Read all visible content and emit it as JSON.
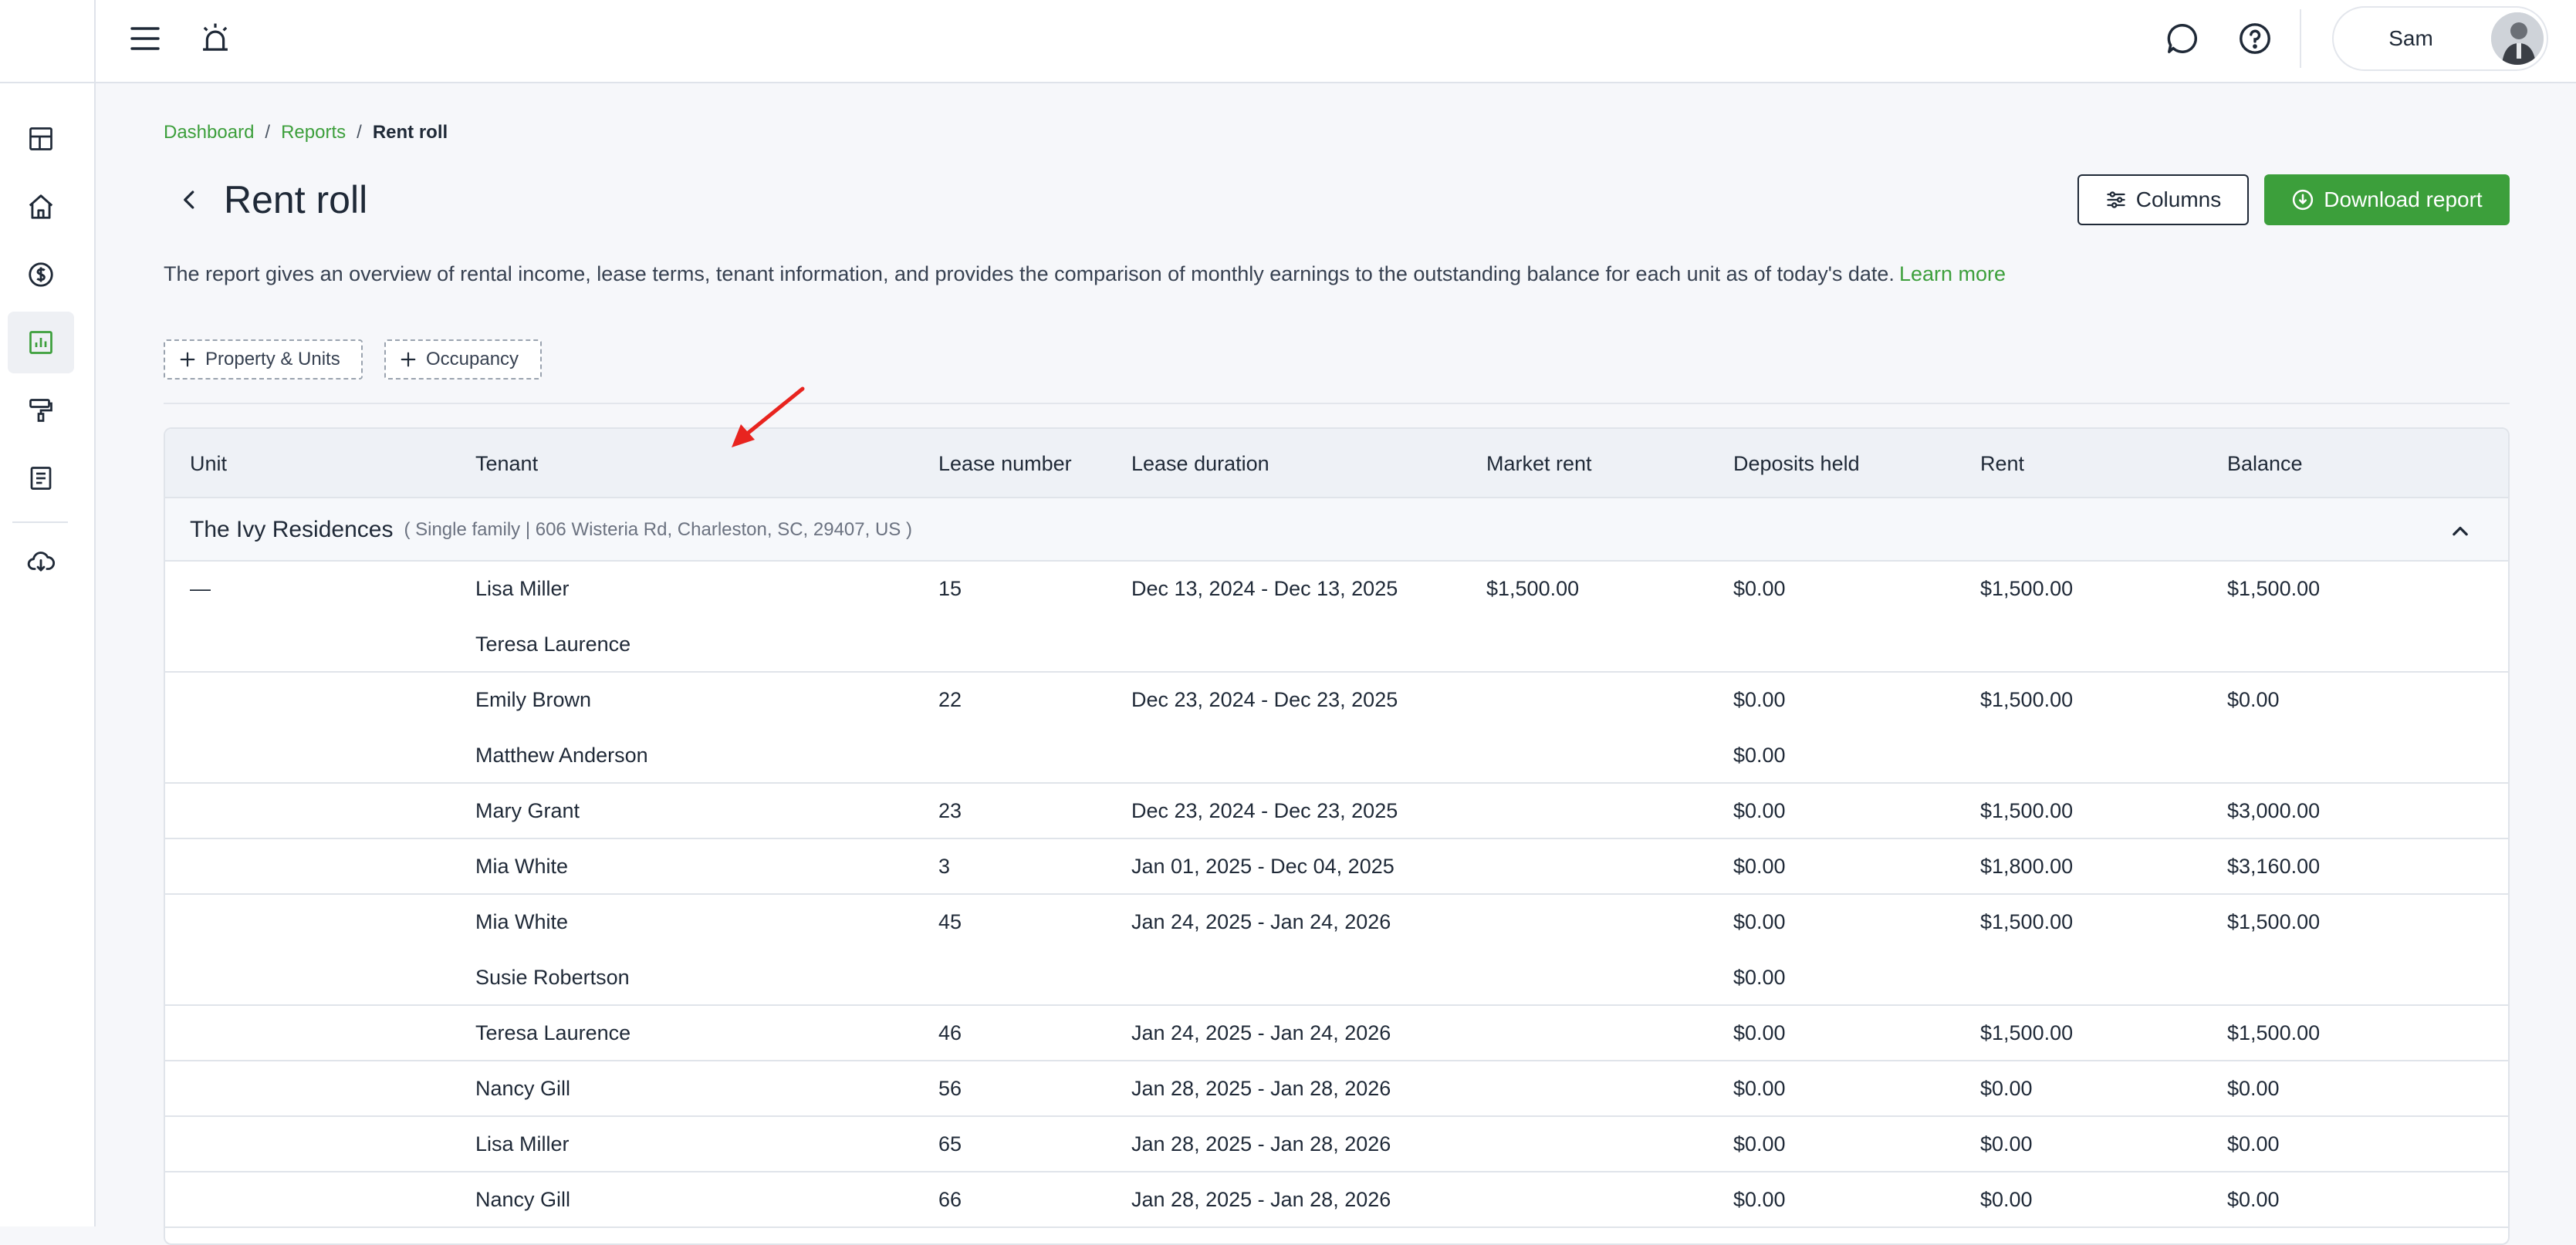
{
  "topbar": {
    "user_name": "Sam"
  },
  "sidebar": {
    "items": [
      {
        "icon": "dashboard-icon",
        "active": false
      },
      {
        "icon": "home-icon",
        "active": false
      },
      {
        "icon": "dollar-icon",
        "active": false
      },
      {
        "icon": "reports-chart-icon",
        "active": true
      },
      {
        "icon": "paint-roller-icon",
        "active": false
      },
      {
        "icon": "document-icon",
        "active": false
      },
      {
        "icon": "cloud-download-icon",
        "active": false
      }
    ]
  },
  "breadcrumb": {
    "items": [
      "Dashboard",
      "Reports"
    ],
    "separator": "/",
    "current": "Rent roll"
  },
  "page": {
    "title": "Rent roll",
    "description": "The report gives an overview of rental income, lease terms, tenant information, and provides the comparison of monthly earnings to the outstanding balance for each unit as of today's date.",
    "learn_more": "Learn more",
    "columns_label": "Columns",
    "download_label": "Download report"
  },
  "filters": [
    {
      "label": "Property & Units"
    },
    {
      "label": "Occupancy"
    }
  ],
  "table": {
    "headers": [
      "Unit",
      "Tenant",
      "Lease number",
      "Lease duration",
      "Market rent",
      "Deposits held",
      "Rent",
      "Balance"
    ],
    "group": {
      "name": "The Ivy Residences",
      "meta": "( Single family | 606 Wisteria Rd, Charleston, SC, 29407, US )"
    },
    "rows": [
      {
        "unit": "—",
        "tenants": [
          "Lisa Miller",
          "Teresa Laurence"
        ],
        "lease_number": "15",
        "lease_duration": "Dec 13, 2024 - Dec 13, 2025",
        "market_rent": "$1,500.00",
        "deposits": [
          "$0.00"
        ],
        "rent": "$1,500.00",
        "balance": "$1,500.00"
      },
      {
        "unit": "",
        "tenants": [
          "Emily Brown",
          "Matthew Anderson"
        ],
        "lease_number": "22",
        "lease_duration": "Dec 23, 2024 - Dec 23, 2025",
        "market_rent": "",
        "deposits": [
          "$0.00",
          "$0.00"
        ],
        "rent": "$1,500.00",
        "balance": "$0.00"
      },
      {
        "unit": "",
        "tenants": [
          "Mary Grant"
        ],
        "lease_number": "23",
        "lease_duration": "Dec 23, 2024 - Dec 23, 2025",
        "market_rent": "",
        "deposits": [
          "$0.00"
        ],
        "rent": "$1,500.00",
        "balance": "$3,000.00"
      },
      {
        "unit": "",
        "tenants": [
          "Mia White"
        ],
        "lease_number": "3",
        "lease_duration": "Jan 01, 2025 - Dec 04, 2025",
        "market_rent": "",
        "deposits": [
          "$0.00"
        ],
        "rent": "$1,800.00",
        "balance": "$3,160.00"
      },
      {
        "unit": "",
        "tenants": [
          "Mia White",
          "Susie Robertson"
        ],
        "lease_number": "45",
        "lease_duration": "Jan 24, 2025 - Jan 24, 2026",
        "market_rent": "",
        "deposits": [
          "$0.00",
          "$0.00"
        ],
        "rent": "$1,500.00",
        "balance": "$1,500.00"
      },
      {
        "unit": "",
        "tenants": [
          "Teresa Laurence"
        ],
        "lease_number": "46",
        "lease_duration": "Jan 24, 2025 - Jan 24, 2026",
        "market_rent": "",
        "deposits": [
          "$0.00"
        ],
        "rent": "$1,500.00",
        "balance": "$1,500.00"
      },
      {
        "unit": "",
        "tenants": [
          "Nancy Gill"
        ],
        "lease_number": "56",
        "lease_duration": "Jan 28, 2025 - Jan 28, 2026",
        "market_rent": "",
        "deposits": [
          "$0.00"
        ],
        "rent": "$0.00",
        "balance": "$0.00"
      },
      {
        "unit": "",
        "tenants": [
          "Lisa Miller"
        ],
        "lease_number": "65",
        "lease_duration": "Jan 28, 2025 - Jan 28, 2026",
        "market_rent": "",
        "deposits": [
          "$0.00"
        ],
        "rent": "$0.00",
        "balance": "$0.00"
      },
      {
        "unit": "",
        "tenants": [
          "Nancy Gill"
        ],
        "lease_number": "66",
        "lease_duration": "Jan 28, 2025 - Jan 28, 2026",
        "market_rent": "",
        "deposits": [
          "$0.00"
        ],
        "rent": "$0.00",
        "balance": "$0.00"
      }
    ]
  },
  "colors": {
    "accent_green": "#3c9f3b",
    "annotation_arrow": "#e8241f"
  }
}
